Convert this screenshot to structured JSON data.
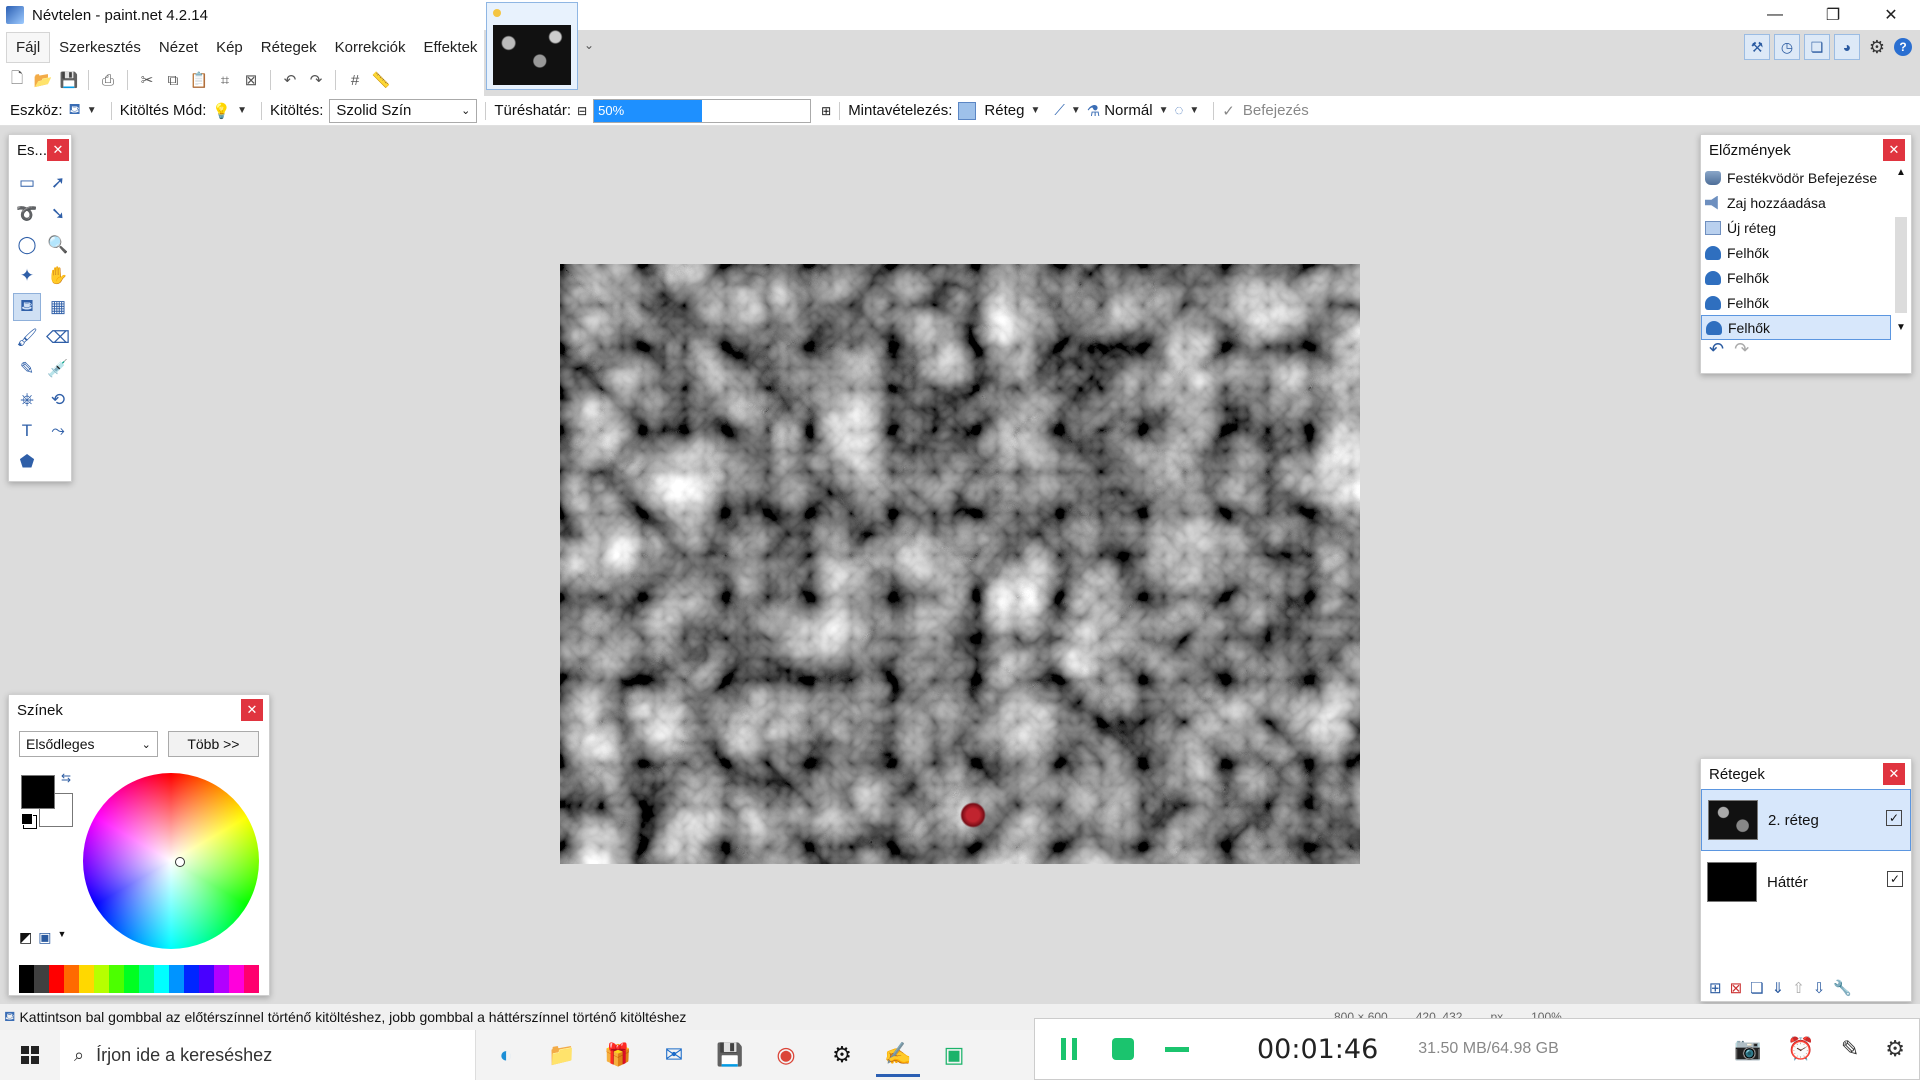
{
  "window": {
    "title": "Névtelen - paint.net 4.2.14",
    "controls": [
      "—",
      "❐",
      "✕"
    ]
  },
  "menu": {
    "items": [
      "Fájl",
      "Szerkesztés",
      "Nézet",
      "Kép",
      "Rétegek",
      "Korrekciók",
      "Effektek"
    ]
  },
  "options": {
    "tool_label": "Eszköz:",
    "fill_mode_label": "Kitöltés Mód:",
    "fill_label": "Kitöltés:",
    "fill_value": "Szolid Szín",
    "tolerance_label": "Türéshatár:",
    "tolerance_value": "50%",
    "tolerance_fraction": 0.5,
    "sampling_label": "Mintavételezés:",
    "sampling_value": "Réteg",
    "blend_value": "Normál",
    "finish_label": "Befejezés"
  },
  "tools_panel": {
    "title": "Es...",
    "selected_index": 8
  },
  "history": {
    "title": "Előzmények",
    "items": [
      {
        "label": "Festékvödör Befejezése",
        "icon": "bucket-icon"
      },
      {
        "label": "Zaj hozzáadása",
        "icon": "noise-icon"
      },
      {
        "label": "Új réteg",
        "icon": "layer-icon"
      },
      {
        "label": "Felhők",
        "icon": "cloud-icon"
      },
      {
        "label": "Felhők",
        "icon": "cloud-icon"
      },
      {
        "label": "Felhők",
        "icon": "cloud-icon"
      },
      {
        "label": "Felhők",
        "icon": "cloud-icon"
      }
    ],
    "selected_index": 6
  },
  "colors": {
    "title": "Színek",
    "mode": "Elsődleges",
    "more": "Több >>",
    "primary": "#000000",
    "secondary": "#ffffff",
    "palette": [
      "#000000",
      "#404040",
      "#ff0000",
      "#ff6a00",
      "#ffd800",
      "#b6ff00",
      "#4cff00",
      "#00ff21",
      "#00ff90",
      "#00ffff",
      "#0094ff",
      "#0026ff",
      "#4800ff",
      "#b200ff",
      "#ff00dc",
      "#ff006e"
    ]
  },
  "layers": {
    "title": "Rétegek",
    "items": [
      {
        "name": "2. réteg",
        "visible": true,
        "selected": true
      },
      {
        "name": "Háttér",
        "visible": true,
        "selected": false
      }
    ]
  },
  "status": {
    "hint": "Kattintson bal gombbal az előtérszínnel történő kitöltéshez, jobb gombbal a háttérszínnel történő kitöltéshez",
    "size": "800 × 600",
    "coords": "420, 432",
    "unit": "px",
    "zoom": "100%"
  },
  "taskbar": {
    "search_placeholder": "Írjon ide a kereséshez"
  },
  "recorder": {
    "time": "00:01:46",
    "size": "31.50 MB/64.98 GB"
  }
}
